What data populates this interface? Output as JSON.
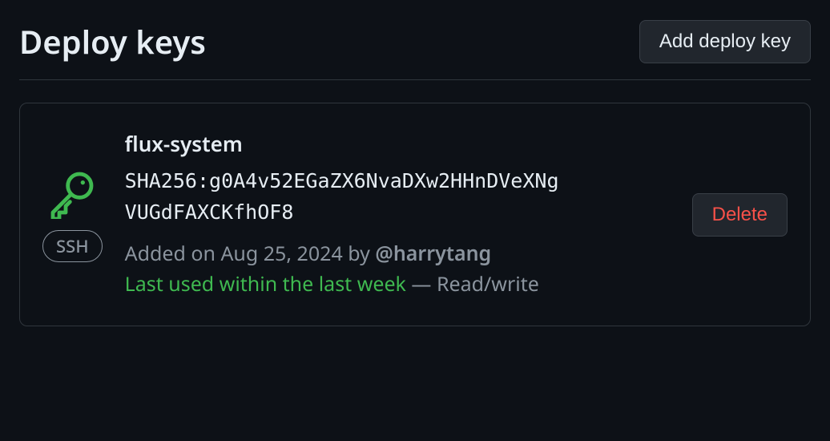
{
  "header": {
    "title": "Deploy keys",
    "add_button": "Add deploy key"
  },
  "key": {
    "name": "flux-system",
    "fingerprint": "SHA256:g0A4v52EGaZX6NvaDXw2HHnDVeXNg VUGdFAXCKfhOF8",
    "badge": "SSH",
    "added_prefix": "Added on ",
    "added_date": "Aug 25, 2024",
    "added_by": " by ",
    "username": "@harrytang",
    "last_used": "Last used within the last week",
    "separator": " — ",
    "access": "Read/write",
    "delete_button": "Delete"
  }
}
